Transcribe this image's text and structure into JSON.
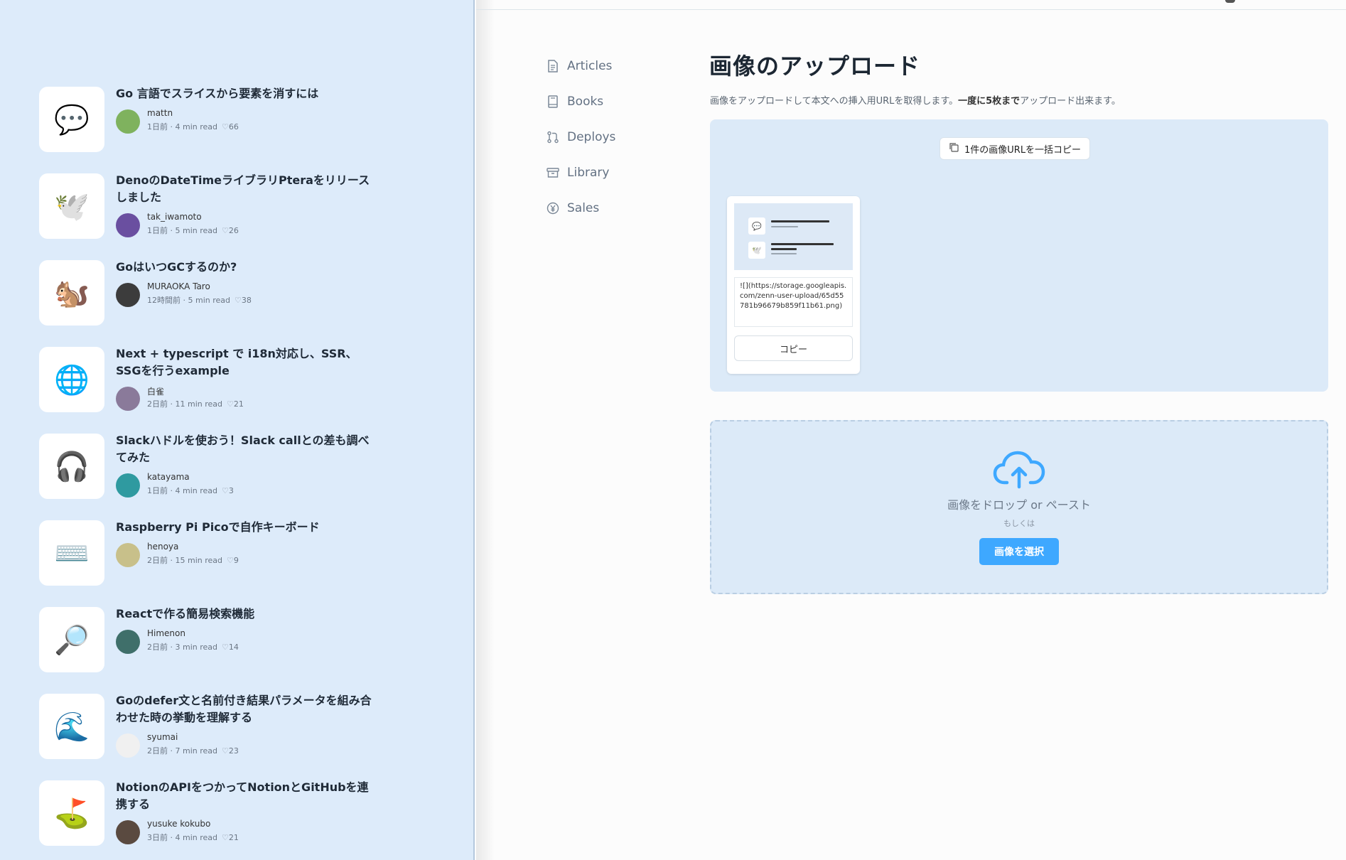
{
  "articles": [
    {
      "emoji": "💬",
      "title": "Go 言語でスライスから要素を消すには",
      "author": "mattn",
      "time": "1日前",
      "read": "4 min read",
      "likes": "66",
      "avatar_color": "#7fb25e"
    },
    {
      "emoji": "🕊️",
      "title": "DenoのDateTimeライブラリPteraをリリースしました",
      "author": "tak_iwamoto",
      "time": "1日前",
      "read": "5 min read",
      "likes": "26",
      "avatar_color": "#6a4fa0"
    },
    {
      "emoji": "🐿️",
      "title": "GoはいつGCするのか?",
      "author": "MURAOKA Taro",
      "time": "12時間前",
      "read": "5 min read",
      "likes": "38",
      "avatar_color": "#3c3c3c"
    },
    {
      "emoji": "🌐",
      "title": "Next + typescript で i18n対応し、SSR、SSGを行うexample",
      "author": "白雀",
      "time": "2日前",
      "read": "11 min read",
      "likes": "21",
      "avatar_color": "#8a7a9a"
    },
    {
      "emoji": "🎧",
      "title": "Slackハドルを使おう！Slack callとの差も調べてみた",
      "author": "katayama",
      "time": "1日前",
      "read": "4 min read",
      "likes": "3",
      "avatar_color": "#2f9aa0"
    },
    {
      "emoji": "⌨️",
      "title": "Raspberry Pi Picoで自作キーボード",
      "author": "henoya",
      "time": "2日前",
      "read": "15 min read",
      "likes": "9",
      "avatar_color": "#c8c08a"
    },
    {
      "emoji": "🔎",
      "title": "Reactで作る簡易検索機能",
      "author": "Himenon",
      "time": "2日前",
      "read": "3 min read",
      "likes": "14",
      "avatar_color": "#3f6f6a"
    },
    {
      "emoji": "🌊",
      "title": "Goのdefer文と名前付き結果パラメータを組み合わせた時の挙動を理解する",
      "author": "syumai",
      "time": "2日前",
      "read": "7 min read",
      "likes": "23",
      "avatar_color": "#f0f0f0"
    },
    {
      "emoji": "⛳",
      "title": "NotionのAPIをつかってNotionとGitHubを連携する",
      "author": "yusuke kokubo",
      "time": "3日前",
      "read": "4 min read",
      "likes": "21",
      "avatar_color": "#5a4a40"
    }
  ],
  "nav": [
    {
      "label": "Articles",
      "icon": "document-icon"
    },
    {
      "label": "Books",
      "icon": "book-icon"
    },
    {
      "label": "Deploys",
      "icon": "git-pull-request-icon"
    },
    {
      "label": "Library",
      "icon": "archive-icon"
    },
    {
      "label": "Sales",
      "icon": "yen-icon"
    }
  ],
  "main": {
    "title": "画像のアップロード",
    "description": "画像をアップロードして本文への挿入用URLを取得します。",
    "description_bold": "一度に5枚まで",
    "description_tail": "アップロード出来ます。",
    "copy_all_label": "1件の画像URLを一括コピー",
    "image_url": "![](https://storage.googleapis.com/zenn-user-upload/65d55781b96679b859f11b61.png)",
    "card_copy_label": "コピー",
    "drop_text": "画像をドロップ or ペースト",
    "or_text": "もしくは",
    "select_label": "画像を選択"
  },
  "colors": {
    "accent": "#3ea8ff",
    "panel": "#dceaf8",
    "feed_bg": "#ddebfa"
  }
}
